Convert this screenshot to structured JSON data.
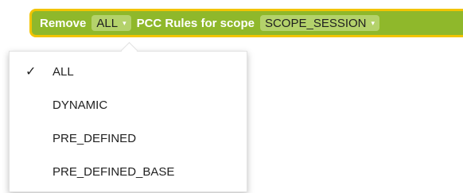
{
  "block": {
    "prefix": "Remove",
    "middle": "PCC Rules for scope",
    "mode_value": "ALL",
    "scope_value": "SCOPE_SESSION",
    "dropdown_arrow": "▾"
  },
  "dropdown": {
    "items": [
      {
        "label": "ALL",
        "check": "✓"
      },
      {
        "label": "DYNAMIC",
        "check": ""
      },
      {
        "label": "PRE_DEFINED",
        "check": ""
      },
      {
        "label": "PRE_DEFINED_BASE",
        "check": ""
      }
    ]
  },
  "colors": {
    "block_fill": "#8fb82b",
    "block_border": "#f2c400",
    "field_fill": "#b4d26b"
  }
}
